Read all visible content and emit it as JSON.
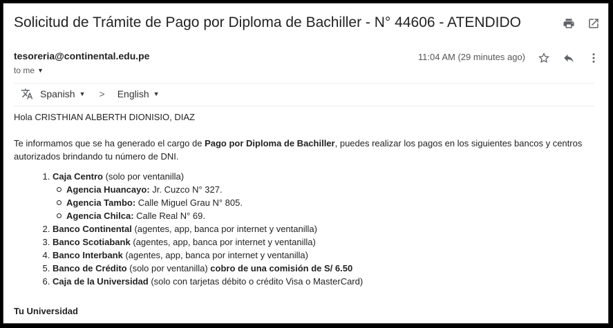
{
  "email": {
    "subject": "Solicitud de Trámite de Pago por Diploma de Bachiller - N° 44606 - ATENDIDO",
    "sender": "tesoreria@continental.edu.pe",
    "time": "11:04 AM (29 minutes ago)",
    "to_label": "to me",
    "icons": {
      "print": "print-icon",
      "open_new_window": "open-in-new-icon",
      "star": "star-icon",
      "reply": "reply-icon",
      "more": "more-vert-icon",
      "translate": "translate-icon"
    }
  },
  "translate": {
    "from_lang": "Spanish",
    "arrow": ">",
    "to_lang": "English"
  },
  "body": {
    "greeting": "Hola CRISTHIAN ALBERTH DIONISIO, DIAZ",
    "intro_1": "Te informamos que se ha generado el cargo de ",
    "intro_bold": "Pago por Diploma de Bachiller",
    "intro_2": ", puedes realizar los pagos en los siguientes bancos y centros autorizados brindando tu número de DNI.",
    "items": [
      {
        "bold": "Caja Centro",
        "text": " (solo por ventanilla)"
      },
      {
        "bold": "Banco Continental",
        "text": " (agentes, app, banca por internet y ventanilla)"
      },
      {
        "bold": "Banco Scotiabank",
        "text": " (agentes, app, banca por internet y ventanilla)"
      },
      {
        "bold": "Banco Interbank",
        "text": " (agentes, app, banca por internet y ventanilla)"
      },
      {
        "bold": "Banco de Crédito",
        "text": " (solo por ventanilla) ",
        "bold2": "cobro de una comisión de S/ 6.50"
      },
      {
        "bold": "Caja de la Universidad",
        "text": " (solo con tarjetas débito o crédito Visa o MasterCard)"
      }
    ],
    "sub_items": [
      {
        "bold": "Agencia Huancayo:",
        "text": " Jr. Cuzco N° 327."
      },
      {
        "bold": "Agencia Tambo:",
        "text": " Calle Miguel Grau N° 805."
      },
      {
        "bold": "Agencia Chilca:",
        "text": " Calle Real N° 69."
      }
    ],
    "signature": "Tu Universidad"
  }
}
